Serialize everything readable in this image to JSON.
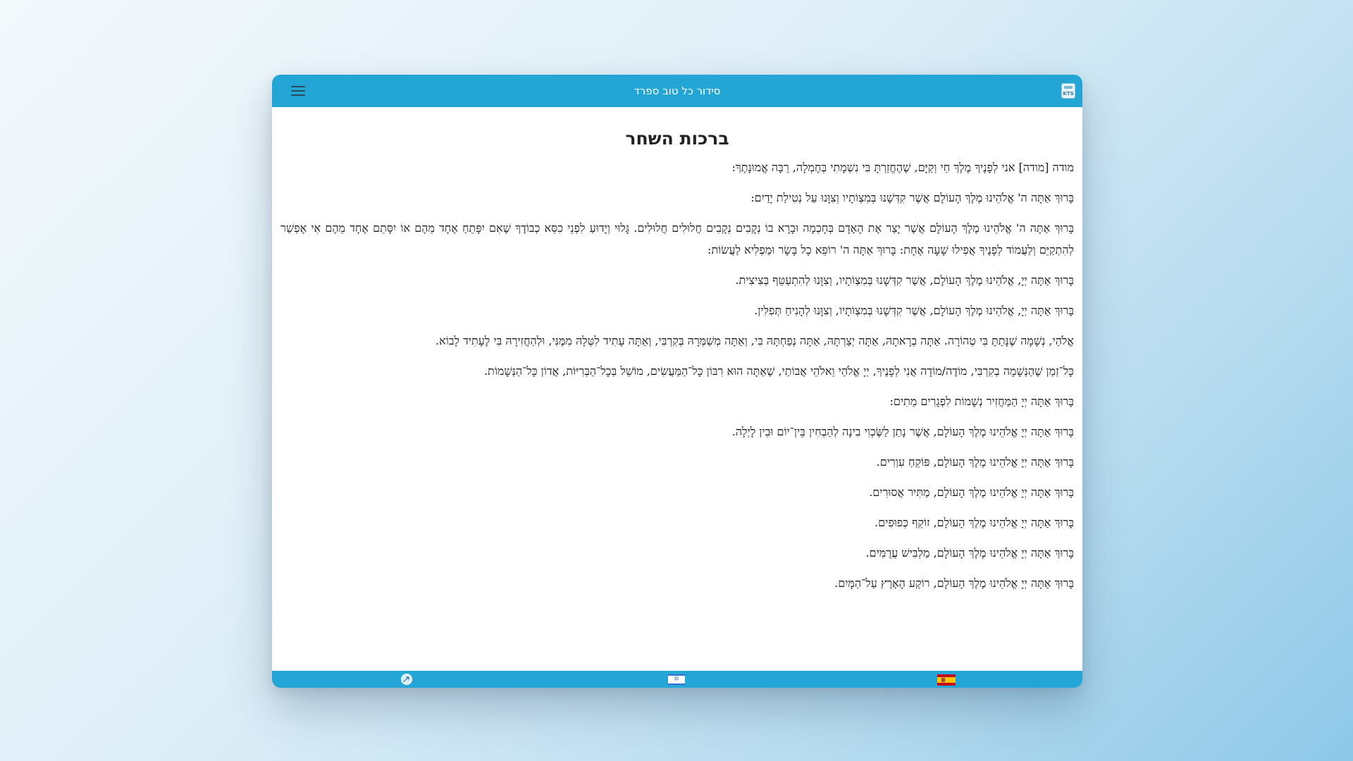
{
  "header": {
    "title": "סידור כל טוב ספרד",
    "menu_icon": "hamburger-menu-icon",
    "app_icon": "kts-app-icon",
    "app_icon_label": "KTS",
    "color": "#23a6d6"
  },
  "main": {
    "title": "ברכות השחר",
    "paragraphs": [
      "מודה [מודה] אני לְפָנֶיךָ מֶלֶךְ חַי וְקַיָּם, שֶׁהֶחֱזַרְתָּ בִּי נִשְׁמָתִי בְּחֶמְלָה, רַבָּה אֱמוּנָתֶךָ:",
      "בָּרוּךְ אַתָּה ה' אֱלֹהֵינוּ מֶלֶךְ הָעוֹלָם אֲשֶׁר קִדְּשָׁנוּ בְּמִצְוֹתָיו וְצִוָּנוּ עַל נְטִילַת יָדַיִם:",
      "בָּרוּךְ אַתָּה ה' אֱלֹהֵינוּ מֶלֶךְ הָעוֹלָם אֲשֶׁר יָצַר אֶת הָאָדָם בְּחָכְמָה וּבָרָא בוֹ נְקָבִים נְקָבִים חֲלוּלִים חֲלוּלִים. גָּלוּי וְיָדוּעַ לִפְנֵי כִסֵּא כְבוֹדֶךָ שֶׁאִם יִפָּתֵחַ אֶחָד מֵהֶם אוֹ יִסָּתֵם אֶחָד מֵהֶם אִי אֶפְשַׁר לְהִתְקַיֵּם וְלַעֲמוֹד לְפָנֶיךָ אֲפִילוּ שָׁעָה אֶחָת: בָּרוּךְ אַתָּה ה' רוֹפֵא כָל בָּשָׂר וּמַפְלִיא לַעֲשׂוֹת:",
      "בָּרוּךְ אַתָּה יְיָ, אֱלֹהֵינוּ מֶלֶךְ הָעוֹלָם, אֲשֶׁר קִדְּשָׁנוּ בְּמִצְוֹתָיו, וְצִוָּנוּ לְהִתְעַטֵּף בְּצִיצִית.",
      "בָּרוּךְ אַתָּה יְיָ, אֱלֹהֵינוּ מֶלֶךְ הָעוֹלָם, אֲשֶׁר קִדְּשָׁנוּ בְּמִצְוֹתָיו, וְצִוָּנוּ לְהָנִיחַ תְּפִלִּין.",
      "אֱלֹהַי, נְשָׁמָה שֶׁנָּתַתָּ בִּי טְהוֹרָה. אַתָּה בְרָאתָהּ, אַתָּה יְצַרְתָּהּ, אַתָּה נְפַחְתָּהּ בִּי, וְאַתָּה מְשַׁמְּרָהּ בְּקִרְבִּי, וְאַתָּה עָתִיד לִטְּלָהּ מִמֶּנִּי, וּלְהַחֲזִירָהּ בִּי לֶעָתִיד לָבוֹא.",
      "כָּל־זְמַן שֶׁהַנְּשָׁמָה בְקִרְבִּי, מוֹדֶה/מוֹדָה אֲנִי לְפָנֶיךָ, יְיָ אֱלֹהַי וֵאלֹהֵי אֲבוֹתַי, שֶׁאַתָּה הוּא רִבּוֹן כָּל־הַמַּעֲשִׂים, מוֹשֵׁל בְּכָל־הַבְּרִיּוֹת, אֲדוֹן כָּל־הַנְּשָׁמוֹת.",
      "בָּרוּךְ אַתָּה יְיָ הַמַּחֲזִיר נְשָׁמוֹת לִפְגָרִים מֵתִים:",
      "בָּרוּךְ אַתָּה יְיָ אֱלֹהֵינוּ מֶלֶךְ הָעוֹלָם, אֲשֶׁר נָתַן לַשֶּׂכְוִי בִינָה לְהַבְחִין בֵּין־יוֹם וּבֵין לָיְלָה.",
      "בָּרוּךְ אַתָּה יְיָ אֱלֹהֵינוּ מֶלֶךְ הָעוֹלָם, פּוֹקֵחַ עִוְרִים.",
      "בָּרוּךְ אַתָּה יְיָ אֱלֹהֵינוּ מֶלֶךְ הָעוֹלָם, מַתִּיר אֲסוּרִים.",
      "בָּרוּךְ אַתָּה יְיָ אֱלֹהֵינוּ מֶלֶךְ הָעוֹלָם, זוֹקֵף כְּפוּפִים.",
      "בָּרוּךְ אַתָּה יְיָ אֱלֹהֵינוּ מֶלֶךְ הָעוֹלָם, מַלְבִּישׁ עֲרֻמִּים.",
      "בָּרוּךְ אַתָּה יְיָ אֱלֹהֵינוּ מֶלֶךְ הָעוֹלָם, רוֹקַע הָאָרֶץ עַל־הַמָּיִם."
    ]
  },
  "footer": {
    "icons": [
      "share-icon",
      "israel-flag-icon",
      "spain-flag-icon"
    ],
    "israel_flag_glyph": "✡",
    "color": "#23a6d6"
  }
}
